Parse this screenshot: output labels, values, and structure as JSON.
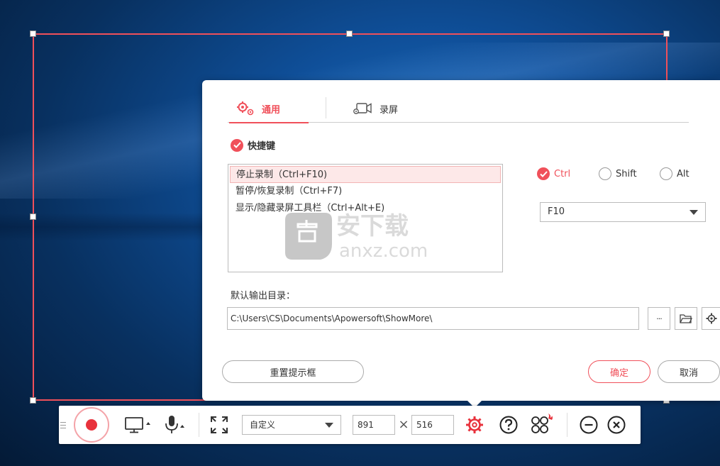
{
  "settings_dialog": {
    "tabs": [
      {
        "label": "通用",
        "active": true
      },
      {
        "label": "录屏",
        "active": false
      }
    ],
    "hotkeys_checkbox_label": "快捷键",
    "hotkey_list": [
      "停止录制（Ctrl+F10)",
      "暂停/恢复录制（Ctrl+F7)",
      "显示/隐藏录屏工具栏（Ctrl+Alt+E)"
    ],
    "modifiers": [
      {
        "label": "Ctrl",
        "checked": true
      },
      {
        "label": "Shift",
        "checked": false
      },
      {
        "label": "Alt",
        "checked": false
      }
    ],
    "key_select_value": "F10",
    "output_dir_label": "默认输出目录：",
    "output_dir_value": "C:\\Users\\CS\\Documents\\Apowersoft\\ShowMore\\",
    "browse_label": "···",
    "reset_tips_label": "重置提示框",
    "ok_label": "确定",
    "cancel_label": "取消"
  },
  "toolbar": {
    "region_mode_value": "自定义",
    "width_value": "891",
    "height_value": "516",
    "times_sign": "×"
  },
  "watermark": {
    "text_cn": "安下载",
    "text_en": "anxz.com"
  },
  "colors": {
    "accent": "#f0505a",
    "record": "#e8323c"
  }
}
